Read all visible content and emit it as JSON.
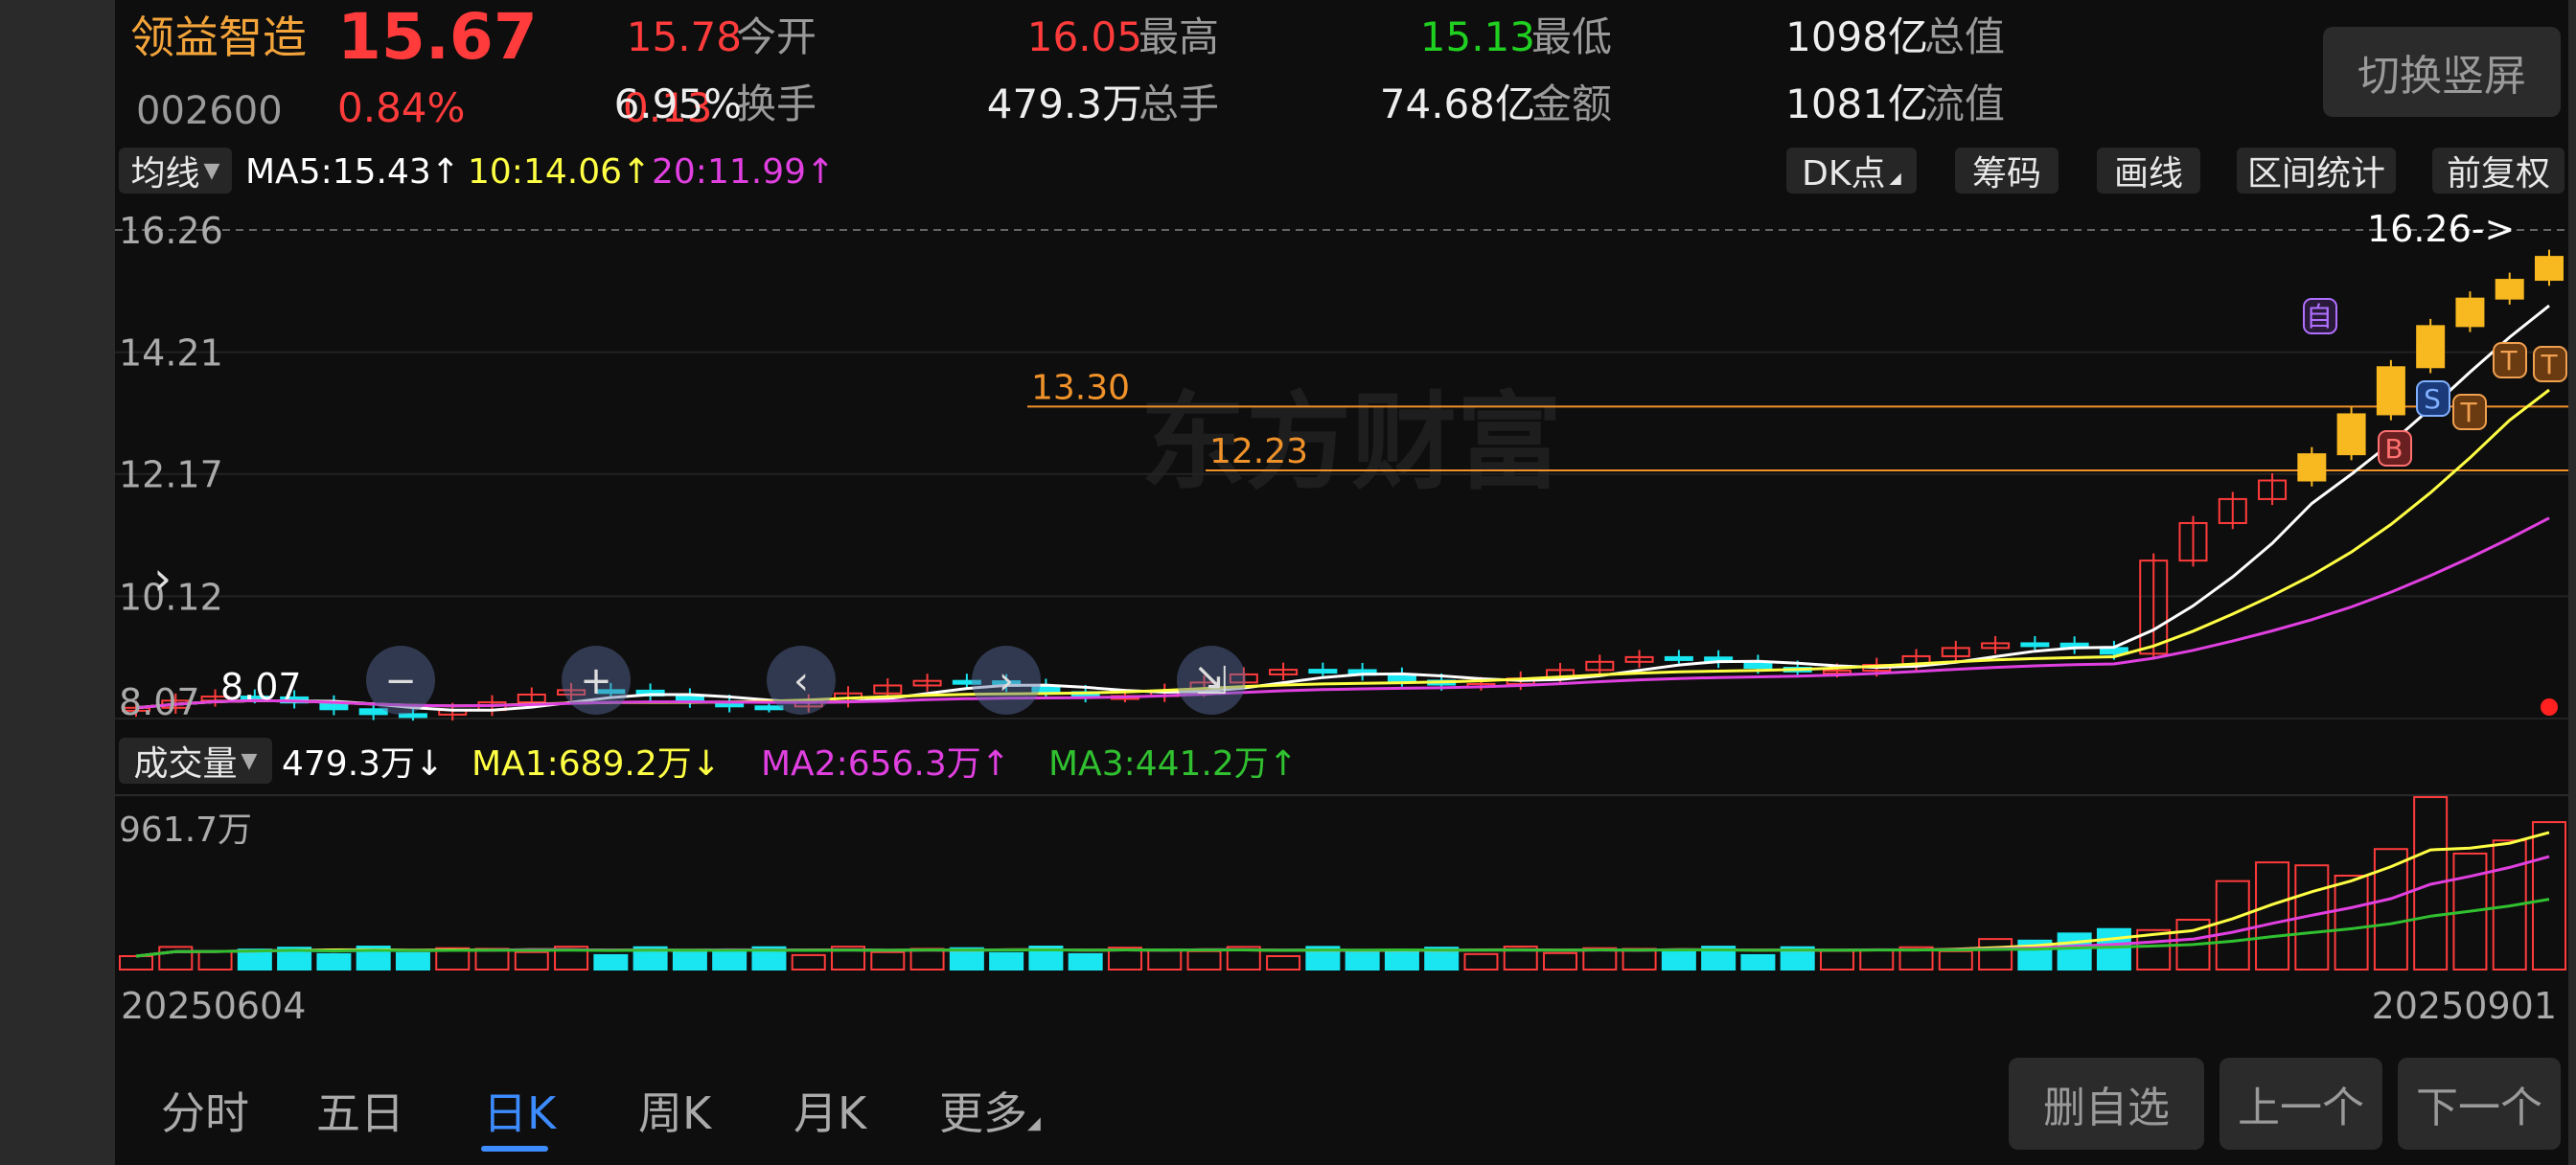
{
  "stock": {
    "name": "领益智造",
    "price": "15.67",
    "code": "002600",
    "change_pct": "0.84%",
    "change": "0.13"
  },
  "quote": {
    "open_label": "今开",
    "open": "15.78",
    "high_label": "最高",
    "high": "16.05",
    "low_label": "最低",
    "low": "15.13",
    "total_cap_label": "总值",
    "total_cap": "1098亿",
    "turnover_label": "换手",
    "turnover": "6.95%",
    "volume_label": "总手",
    "volume": "479.3万",
    "amount_label": "金额",
    "amount": "74.68亿",
    "float_cap_label": "流值",
    "float_cap": "1081亿"
  },
  "switch_button": "切换竖屏",
  "indicator": {
    "selector": "均线",
    "ma5": "MA5:15.43↑",
    "ma10": "10:14.06↑",
    "ma20": "20:11.99↑",
    "tools": [
      "DK点",
      "筹码",
      "画线",
      "区间统计",
      "前复权"
    ]
  },
  "price_axis": [
    "16.26",
    "14.21",
    "12.17",
    "10.12",
    "8.07"
  ],
  "annotations": {
    "high_marker": "16.26->",
    "low_marker": "8.07",
    "level1": "13.30",
    "level2": "12.23",
    "watermark": "东方财富",
    "self_tag": "自",
    "buy_tag": "B",
    "sell_tag": "S",
    "t_tag": "T"
  },
  "volume_panel": {
    "selector": "成交量",
    "current": "479.3万↓",
    "ma1": "MA1:689.2万↓",
    "ma2": "MA2:656.3万↑",
    "ma3": "MA3:441.2万↑",
    "max_label": "961.7万"
  },
  "dates": {
    "start": "20250604",
    "end": "20250901"
  },
  "tabs": [
    "分时",
    "五日",
    "日K",
    "周K",
    "月K",
    "更多"
  ],
  "active_tab": "日K",
  "bottom_buttons": [
    "删自选",
    "上一个",
    "下一个"
  ],
  "colors": {
    "up": "#ff3b3b",
    "down": "#19e6f0",
    "ma5": "#ffffff",
    "ma10": "#ffff44",
    "ma20": "#e040e0",
    "ma3": "#30c030",
    "level": "#f0922a",
    "accent": "#3d8cff"
  }
}
